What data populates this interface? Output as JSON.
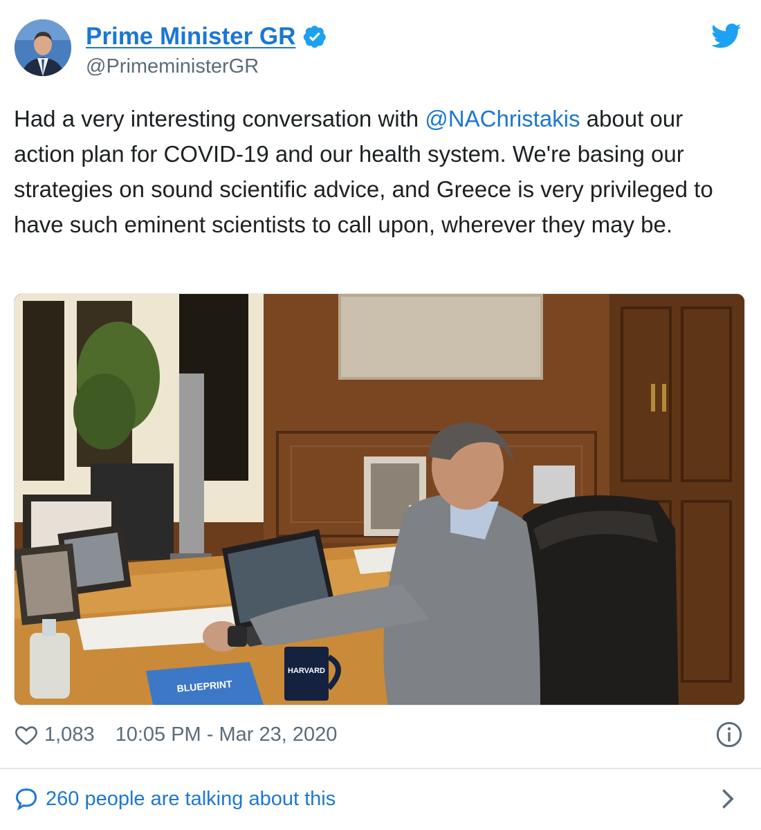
{
  "header": {
    "display_name": "Prime Minister GR",
    "handle": "@PrimeministerGR",
    "verified_icon": "verified-badge-icon",
    "platform_icon": "twitter-bird-icon"
  },
  "tweet": {
    "text_before_mention": "Had a very interesting conversation with ",
    "mention": "@NAChristakis",
    "text_after_mention": " about our action plan for COVID-19 and our health system. We're basing our strategies on sound scientific advice, and Greece is very privileged to have such eminent scientists to call upon, wherever they may be."
  },
  "photo": {
    "mug_text": "HARVARD",
    "book_text": "BLUEPRINT"
  },
  "meta": {
    "like_count": "1,083",
    "timestamp": "10:05 PM - Mar 23, 2020",
    "like_icon": "heart-icon",
    "info_icon": "info-icon"
  },
  "conversation": {
    "label": "260 people are talking about this",
    "icon": "speech-bubble-icon",
    "chevron": "chevron-right-icon"
  },
  "colors": {
    "link_blue": "#1b77d3",
    "twitter_blue": "#1da1f2",
    "text": "#1c2022",
    "muted": "#5b6b78"
  }
}
